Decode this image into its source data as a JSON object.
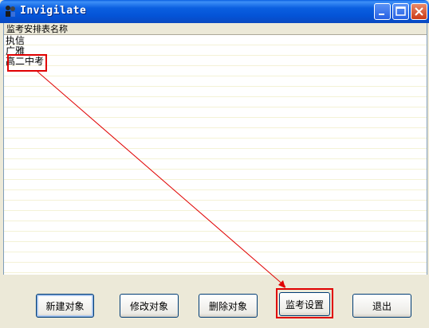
{
  "window": {
    "title": "Invigilate"
  },
  "list": {
    "header": "监考安排表名称",
    "rows": [
      "执信",
      "广雅",
      "高二中考"
    ]
  },
  "buttons": {
    "new": "新建对象",
    "edit": "修改对象",
    "delete": "删除对象",
    "settings": "监考设置",
    "exit": "退出"
  },
  "colors": {
    "titlebar": "#0a5fe0",
    "annotation": "#e00000"
  }
}
